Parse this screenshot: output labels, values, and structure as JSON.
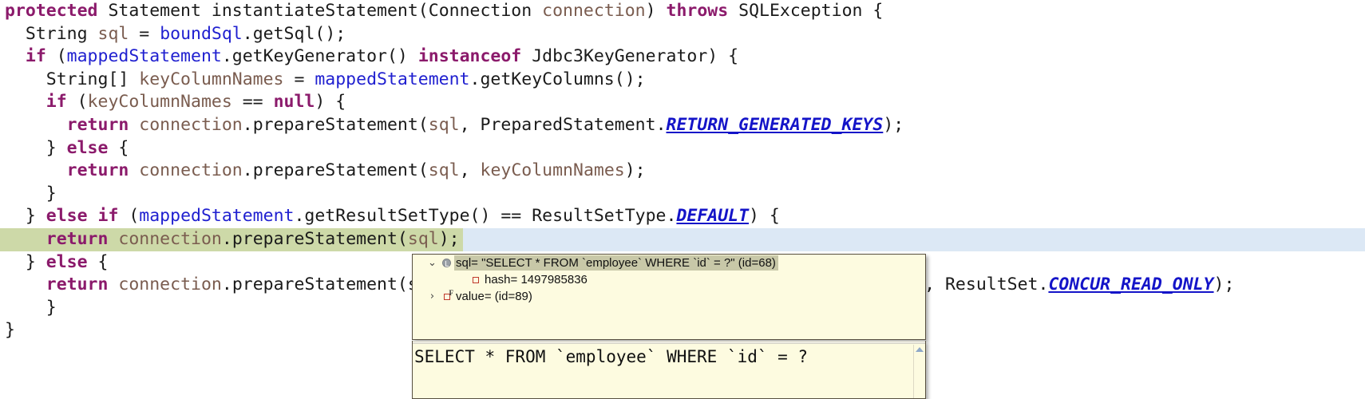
{
  "editor": {
    "lines": [
      {
        "indent": 0,
        "tokens": [
          {
            "t": "protected",
            "c": "kw"
          },
          {
            "t": " ",
            "c": "plain"
          },
          {
            "t": "Statement",
            "c": "plain"
          },
          {
            "t": " ",
            "c": "plain"
          },
          {
            "t": "instantiateStatement",
            "c": "plain"
          },
          {
            "t": "(",
            "c": "plain"
          },
          {
            "t": "Connection",
            "c": "plain"
          },
          {
            "t": " ",
            "c": "plain"
          },
          {
            "t": "connection",
            "c": "par"
          },
          {
            "t": ") ",
            "c": "plain"
          },
          {
            "t": "throws",
            "c": "kw"
          },
          {
            "t": " ",
            "c": "plain"
          },
          {
            "t": "SQLException",
            "c": "plain"
          },
          {
            "t": " {",
            "c": "plain"
          }
        ]
      },
      {
        "indent": 1,
        "tokens": [
          {
            "t": "String",
            "c": "plain"
          },
          {
            "t": " ",
            "c": "plain"
          },
          {
            "t": "sql",
            "c": "par"
          },
          {
            "t": " = ",
            "c": "plain"
          },
          {
            "t": "boundSql",
            "c": "fld"
          },
          {
            "t": ".",
            "c": "plain"
          },
          {
            "t": "getSql",
            "c": "plain"
          },
          {
            "t": "();",
            "c": "plain"
          }
        ]
      },
      {
        "indent": 1,
        "tokens": [
          {
            "t": "if",
            "c": "kw"
          },
          {
            "t": " (",
            "c": "plain"
          },
          {
            "t": "mappedStatement",
            "c": "fld"
          },
          {
            "t": ".",
            "c": "plain"
          },
          {
            "t": "getKeyGenerator",
            "c": "plain"
          },
          {
            "t": "() ",
            "c": "plain"
          },
          {
            "t": "instanceof",
            "c": "kw"
          },
          {
            "t": " ",
            "c": "plain"
          },
          {
            "t": "Jdbc3KeyGenerator",
            "c": "plain"
          },
          {
            "t": ") {",
            "c": "plain"
          }
        ]
      },
      {
        "indent": 2,
        "tokens": [
          {
            "t": "String[] ",
            "c": "plain"
          },
          {
            "t": "keyColumnNames",
            "c": "par"
          },
          {
            "t": " = ",
            "c": "plain"
          },
          {
            "t": "mappedStatement",
            "c": "fld"
          },
          {
            "t": ".",
            "c": "plain"
          },
          {
            "t": "getKeyColumns",
            "c": "plain"
          },
          {
            "t": "();",
            "c": "plain"
          }
        ]
      },
      {
        "indent": 2,
        "tokens": [
          {
            "t": "if",
            "c": "kw"
          },
          {
            "t": " (",
            "c": "plain"
          },
          {
            "t": "keyColumnNames",
            "c": "par"
          },
          {
            "t": " == ",
            "c": "plain"
          },
          {
            "t": "null",
            "c": "kw"
          },
          {
            "t": ") {",
            "c": "plain"
          }
        ]
      },
      {
        "indent": 3,
        "tokens": [
          {
            "t": "return",
            "c": "kw"
          },
          {
            "t": " ",
            "c": "plain"
          },
          {
            "t": "connection",
            "c": "par"
          },
          {
            "t": ".",
            "c": "plain"
          },
          {
            "t": "prepareStatement",
            "c": "plain"
          },
          {
            "t": "(",
            "c": "plain"
          },
          {
            "t": "sql",
            "c": "par"
          },
          {
            "t": ", ",
            "c": "plain"
          },
          {
            "t": "PreparedStatement",
            "c": "plain"
          },
          {
            "t": ".",
            "c": "plain"
          },
          {
            "t": "RETURN_GENERATED_KEYS",
            "c": "cst"
          },
          {
            "t": ");",
            "c": "plain"
          }
        ]
      },
      {
        "indent": 2,
        "tokens": [
          {
            "t": "} ",
            "c": "plain"
          },
          {
            "t": "else",
            "c": "kw"
          },
          {
            "t": " {",
            "c": "plain"
          }
        ]
      },
      {
        "indent": 3,
        "tokens": [
          {
            "t": "return",
            "c": "kw"
          },
          {
            "t": " ",
            "c": "plain"
          },
          {
            "t": "connection",
            "c": "par"
          },
          {
            "t": ".",
            "c": "plain"
          },
          {
            "t": "prepareStatement",
            "c": "plain"
          },
          {
            "t": "(",
            "c": "plain"
          },
          {
            "t": "sql",
            "c": "par"
          },
          {
            "t": ", ",
            "c": "plain"
          },
          {
            "t": "keyColumnNames",
            "c": "par"
          },
          {
            "t": ");",
            "c": "plain"
          }
        ]
      },
      {
        "indent": 2,
        "tokens": [
          {
            "t": "}",
            "c": "plain"
          }
        ]
      },
      {
        "indent": 1,
        "tokens": [
          {
            "t": "} ",
            "c": "plain"
          },
          {
            "t": "else",
            "c": "kw"
          },
          {
            "t": " ",
            "c": "plain"
          },
          {
            "t": "if",
            "c": "kw"
          },
          {
            "t": " (",
            "c": "plain"
          },
          {
            "t": "mappedStatement",
            "c": "fld"
          },
          {
            "t": ".",
            "c": "plain"
          },
          {
            "t": "getResultSetType",
            "c": "plain"
          },
          {
            "t": "() == ",
            "c": "plain"
          },
          {
            "t": "ResultSetType",
            "c": "plain"
          },
          {
            "t": ".",
            "c": "plain"
          },
          {
            "t": "DEFAULT",
            "c": "cst"
          },
          {
            "t": ") {",
            "c": "plain"
          }
        ]
      },
      {
        "indent": 2,
        "exec": true,
        "tokens": [
          {
            "t": "return",
            "c": "kw"
          },
          {
            "t": " ",
            "c": "plain"
          },
          {
            "t": "connection",
            "c": "par"
          },
          {
            "t": ".",
            "c": "plain"
          },
          {
            "t": "prepareStatement",
            "c": "plain"
          },
          {
            "t": "(",
            "c": "plain"
          },
          {
            "t": "sql",
            "c": "par"
          },
          {
            "t": ");",
            "c": "plain"
          }
        ]
      },
      {
        "indent": 1,
        "tokens": [
          {
            "t": "} ",
            "c": "plain"
          },
          {
            "t": "else",
            "c": "kw"
          },
          {
            "t": " {",
            "c": "plain"
          }
        ]
      },
      {
        "indent": 2,
        "tokens": [
          {
            "t": "return",
            "c": "kw"
          },
          {
            "t": " ",
            "c": "plain"
          },
          {
            "t": "connection",
            "c": "par"
          },
          {
            "t": ".",
            "c": "plain"
          },
          {
            "t": "prepareStatement",
            "c": "plain"
          },
          {
            "t": "(",
            "c": "plain"
          },
          {
            "t": "sql, mappedStatement.getResultSetType().getValue()",
            "c": "hidden"
          },
          {
            "t": ", ",
            "c": "plain"
          },
          {
            "t": "ResultSet",
            "c": "plain"
          },
          {
            "t": ".",
            "c": "plain"
          },
          {
            "t": "CONCUR_READ_ONLY",
            "c": "cst"
          },
          {
            "t": ");",
            "c": "plain"
          }
        ]
      },
      {
        "indent": 2,
        "tokens": [
          {
            "t": "}",
            "c": "plain"
          }
        ]
      },
      {
        "indent": 0,
        "tokens": [
          {
            "t": "}",
            "c": "plain"
          }
        ]
      }
    ]
  },
  "popup": {
    "rows": [
      {
        "toggle": "⌄",
        "icon": "field-icon",
        "label": "sql= \"SELECT * FROM `employee` WHERE `id` = ?\" (id=68)",
        "selected": true,
        "depth": 0
      },
      {
        "toggle": "",
        "icon": "primitive-icon",
        "label": "hash= 1497985836",
        "selected": false,
        "depth": 1
      },
      {
        "toggle": "›",
        "icon": "primitive-final-icon",
        "label": "value= (id=89)",
        "selected": false,
        "depth": 0
      }
    ]
  },
  "sql_panel": {
    "text": "SELECT * FROM `employee` WHERE `id` = ?",
    "scroll_icon": "scroll-up-arrow"
  },
  "colors": {
    "keyword": "#8b1a6b",
    "field": "#2020d0",
    "parameter": "#7a5c4f",
    "constant": "#1414c8",
    "exec_line_green": "#cdd9a8",
    "exec_line_blue": "#dce8f5",
    "popup_bg": "#fdfbe0",
    "popup_selected": "#c8c8a8"
  }
}
